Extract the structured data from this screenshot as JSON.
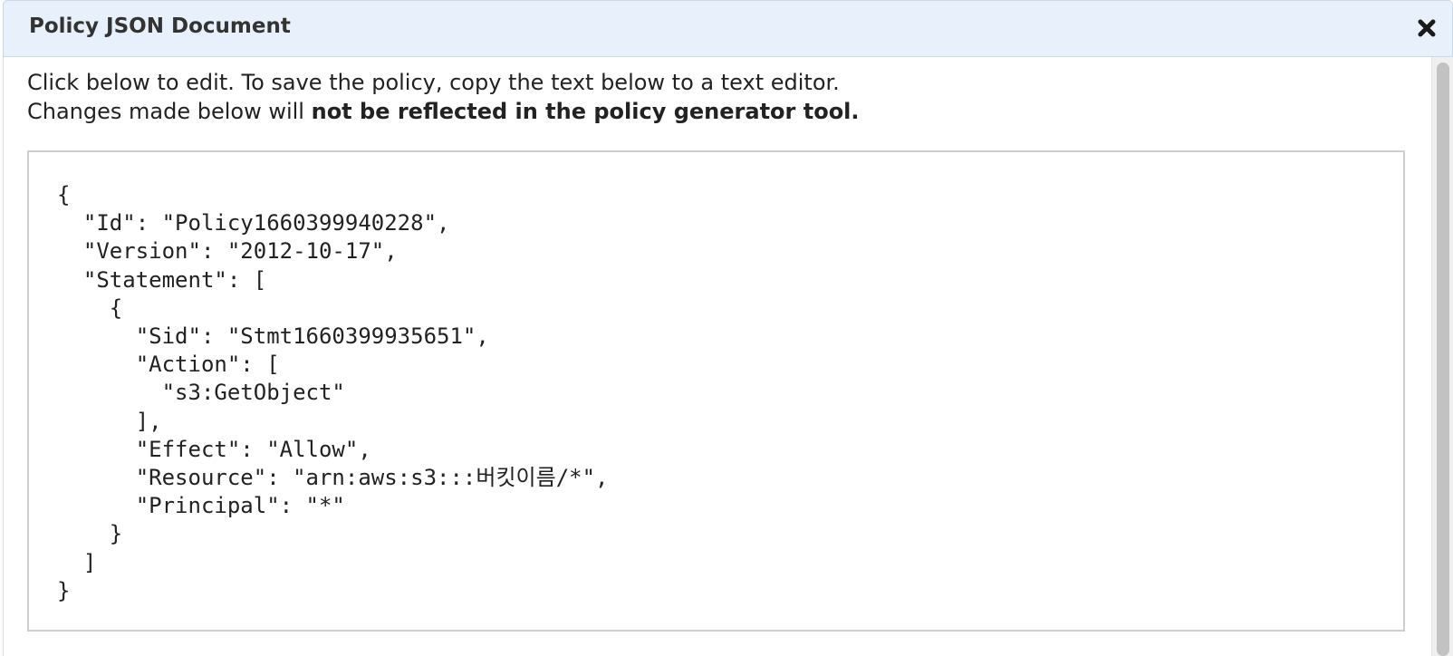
{
  "dialog": {
    "title": "Policy JSON Document",
    "close_icon": "close-icon"
  },
  "instructions": {
    "line1": "Click below to edit. To save the policy, copy the text below to a text editor.",
    "line2_prefix": "Changes made below will ",
    "line2_bold": "not be reflected in the policy generator tool."
  },
  "editor": {
    "content": "{\n  \"Id\": \"Policy1660399940228\",\n  \"Version\": \"2012-10-17\",\n  \"Statement\": [\n    {\n      \"Sid\": \"Stmt1660399935651\",\n      \"Action\": [\n        \"s3:GetObject\"\n      ],\n      \"Effect\": \"Allow\",\n      \"Resource\": \"arn:aws:s3:::버킷이름/*\",\n      \"Principal\": \"*\"\n    }\n  ]\n}"
  },
  "colors": {
    "titlebar_bg": "#e8f1fb",
    "titlebar_border": "#c9d9ec",
    "editor_border": "#cfcfcf",
    "scroll_thumb": "#c2c2c2"
  }
}
